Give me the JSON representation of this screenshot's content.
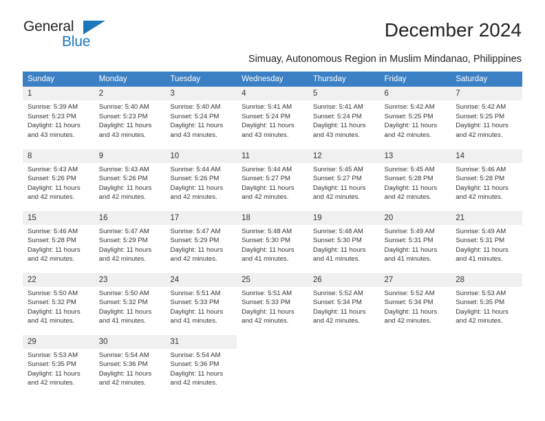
{
  "brand": {
    "name_top": "General",
    "name_bottom": "Blue",
    "accent_color": "#1b76bc"
  },
  "header": {
    "title": "December 2024",
    "subtitle": "Simuay, Autonomous Region in Muslim Mindanao, Philippines"
  },
  "calendar": {
    "header_bg": "#3b7fc4",
    "daynum_bg": "#f0f0f0",
    "weekdays": [
      "Sunday",
      "Monday",
      "Tuesday",
      "Wednesday",
      "Thursday",
      "Friday",
      "Saturday"
    ],
    "weeks": [
      [
        {
          "day": "1",
          "sunrise": "Sunrise: 5:39 AM",
          "sunset": "Sunset: 5:23 PM",
          "daylight_1": "Daylight: 11 hours",
          "daylight_2": "and 43 minutes."
        },
        {
          "day": "2",
          "sunrise": "Sunrise: 5:40 AM",
          "sunset": "Sunset: 5:23 PM",
          "daylight_1": "Daylight: 11 hours",
          "daylight_2": "and 43 minutes."
        },
        {
          "day": "3",
          "sunrise": "Sunrise: 5:40 AM",
          "sunset": "Sunset: 5:24 PM",
          "daylight_1": "Daylight: 11 hours",
          "daylight_2": "and 43 minutes."
        },
        {
          "day": "4",
          "sunrise": "Sunrise: 5:41 AM",
          "sunset": "Sunset: 5:24 PM",
          "daylight_1": "Daylight: 11 hours",
          "daylight_2": "and 43 minutes."
        },
        {
          "day": "5",
          "sunrise": "Sunrise: 5:41 AM",
          "sunset": "Sunset: 5:24 PM",
          "daylight_1": "Daylight: 11 hours",
          "daylight_2": "and 43 minutes."
        },
        {
          "day": "6",
          "sunrise": "Sunrise: 5:42 AM",
          "sunset": "Sunset: 5:25 PM",
          "daylight_1": "Daylight: 11 hours",
          "daylight_2": "and 42 minutes."
        },
        {
          "day": "7",
          "sunrise": "Sunrise: 5:42 AM",
          "sunset": "Sunset: 5:25 PM",
          "daylight_1": "Daylight: 11 hours",
          "daylight_2": "and 42 minutes."
        }
      ],
      [
        {
          "day": "8",
          "sunrise": "Sunrise: 5:43 AM",
          "sunset": "Sunset: 5:26 PM",
          "daylight_1": "Daylight: 11 hours",
          "daylight_2": "and 42 minutes."
        },
        {
          "day": "9",
          "sunrise": "Sunrise: 5:43 AM",
          "sunset": "Sunset: 5:26 PM",
          "daylight_1": "Daylight: 11 hours",
          "daylight_2": "and 42 minutes."
        },
        {
          "day": "10",
          "sunrise": "Sunrise: 5:44 AM",
          "sunset": "Sunset: 5:26 PM",
          "daylight_1": "Daylight: 11 hours",
          "daylight_2": "and 42 minutes."
        },
        {
          "day": "11",
          "sunrise": "Sunrise: 5:44 AM",
          "sunset": "Sunset: 5:27 PM",
          "daylight_1": "Daylight: 11 hours",
          "daylight_2": "and 42 minutes."
        },
        {
          "day": "12",
          "sunrise": "Sunrise: 5:45 AM",
          "sunset": "Sunset: 5:27 PM",
          "daylight_1": "Daylight: 11 hours",
          "daylight_2": "and 42 minutes."
        },
        {
          "day": "13",
          "sunrise": "Sunrise: 5:45 AM",
          "sunset": "Sunset: 5:28 PM",
          "daylight_1": "Daylight: 11 hours",
          "daylight_2": "and 42 minutes."
        },
        {
          "day": "14",
          "sunrise": "Sunrise: 5:46 AM",
          "sunset": "Sunset: 5:28 PM",
          "daylight_1": "Daylight: 11 hours",
          "daylight_2": "and 42 minutes."
        }
      ],
      [
        {
          "day": "15",
          "sunrise": "Sunrise: 5:46 AM",
          "sunset": "Sunset: 5:28 PM",
          "daylight_1": "Daylight: 11 hours",
          "daylight_2": "and 42 minutes."
        },
        {
          "day": "16",
          "sunrise": "Sunrise: 5:47 AM",
          "sunset": "Sunset: 5:29 PM",
          "daylight_1": "Daylight: 11 hours",
          "daylight_2": "and 42 minutes."
        },
        {
          "day": "17",
          "sunrise": "Sunrise: 5:47 AM",
          "sunset": "Sunset: 5:29 PM",
          "daylight_1": "Daylight: 11 hours",
          "daylight_2": "and 42 minutes."
        },
        {
          "day": "18",
          "sunrise": "Sunrise: 5:48 AM",
          "sunset": "Sunset: 5:30 PM",
          "daylight_1": "Daylight: 11 hours",
          "daylight_2": "and 41 minutes."
        },
        {
          "day": "19",
          "sunrise": "Sunrise: 5:48 AM",
          "sunset": "Sunset: 5:30 PM",
          "daylight_1": "Daylight: 11 hours",
          "daylight_2": "and 41 minutes."
        },
        {
          "day": "20",
          "sunrise": "Sunrise: 5:49 AM",
          "sunset": "Sunset: 5:31 PM",
          "daylight_1": "Daylight: 11 hours",
          "daylight_2": "and 41 minutes."
        },
        {
          "day": "21",
          "sunrise": "Sunrise: 5:49 AM",
          "sunset": "Sunset: 5:31 PM",
          "daylight_1": "Daylight: 11 hours",
          "daylight_2": "and 41 minutes."
        }
      ],
      [
        {
          "day": "22",
          "sunrise": "Sunrise: 5:50 AM",
          "sunset": "Sunset: 5:32 PM",
          "daylight_1": "Daylight: 11 hours",
          "daylight_2": "and 41 minutes."
        },
        {
          "day": "23",
          "sunrise": "Sunrise: 5:50 AM",
          "sunset": "Sunset: 5:32 PM",
          "daylight_1": "Daylight: 11 hours",
          "daylight_2": "and 41 minutes."
        },
        {
          "day": "24",
          "sunrise": "Sunrise: 5:51 AM",
          "sunset": "Sunset: 5:33 PM",
          "daylight_1": "Daylight: 11 hours",
          "daylight_2": "and 41 minutes."
        },
        {
          "day": "25",
          "sunrise": "Sunrise: 5:51 AM",
          "sunset": "Sunset: 5:33 PM",
          "daylight_1": "Daylight: 11 hours",
          "daylight_2": "and 42 minutes."
        },
        {
          "day": "26",
          "sunrise": "Sunrise: 5:52 AM",
          "sunset": "Sunset: 5:34 PM",
          "daylight_1": "Daylight: 11 hours",
          "daylight_2": "and 42 minutes."
        },
        {
          "day": "27",
          "sunrise": "Sunrise: 5:52 AM",
          "sunset": "Sunset: 5:34 PM",
          "daylight_1": "Daylight: 11 hours",
          "daylight_2": "and 42 minutes."
        },
        {
          "day": "28",
          "sunrise": "Sunrise: 5:53 AM",
          "sunset": "Sunset: 5:35 PM",
          "daylight_1": "Daylight: 11 hours",
          "daylight_2": "and 42 minutes."
        }
      ],
      [
        {
          "day": "29",
          "sunrise": "Sunrise: 5:53 AM",
          "sunset": "Sunset: 5:35 PM",
          "daylight_1": "Daylight: 11 hours",
          "daylight_2": "and 42 minutes."
        },
        {
          "day": "30",
          "sunrise": "Sunrise: 5:54 AM",
          "sunset": "Sunset: 5:36 PM",
          "daylight_1": "Daylight: 11 hours",
          "daylight_2": "and 42 minutes."
        },
        {
          "day": "31",
          "sunrise": "Sunrise: 5:54 AM",
          "sunset": "Sunset: 5:36 PM",
          "daylight_1": "Daylight: 11 hours",
          "daylight_2": "and 42 minutes."
        },
        {
          "day": "",
          "sunrise": "",
          "sunset": "",
          "daylight_1": "",
          "daylight_2": ""
        },
        {
          "day": "",
          "sunrise": "",
          "sunset": "",
          "daylight_1": "",
          "daylight_2": ""
        },
        {
          "day": "",
          "sunrise": "",
          "sunset": "",
          "daylight_1": "",
          "daylight_2": ""
        },
        {
          "day": "",
          "sunrise": "",
          "sunset": "",
          "daylight_1": "",
          "daylight_2": ""
        }
      ]
    ]
  }
}
